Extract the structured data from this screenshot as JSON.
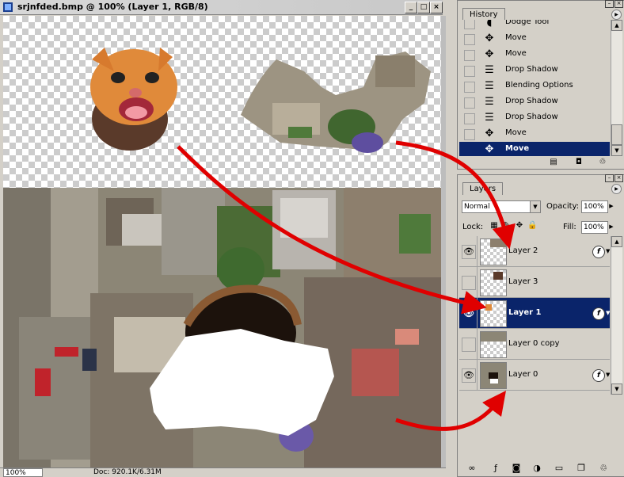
{
  "document": {
    "title": "srjnfded.bmp @ 100% (Layer 1, RGB/8)",
    "window_buttons": {
      "minimize": "_",
      "maximize": "□",
      "close": "×"
    },
    "status": {
      "zoom": "100%",
      "doc_size": "Doc: 920.1K/6.31M"
    }
  },
  "history": {
    "tab_label": "History",
    "items": [
      {
        "label": "Dodge Tool",
        "icon": "dodge-icon",
        "selected": false
      },
      {
        "label": "Move",
        "icon": "move-tool-icon",
        "selected": false
      },
      {
        "label": "Move",
        "icon": "move-tool-icon",
        "selected": false
      },
      {
        "label": "Drop Shadow",
        "icon": "document-step-icon",
        "selected": false
      },
      {
        "label": "Blending Options",
        "icon": "document-step-icon",
        "selected": false
      },
      {
        "label": "Drop Shadow",
        "icon": "document-step-icon",
        "selected": false
      },
      {
        "label": "Drop Shadow",
        "icon": "document-step-icon",
        "selected": false
      },
      {
        "label": "Move",
        "icon": "move-tool-icon",
        "selected": false
      },
      {
        "label": "Move",
        "icon": "move-tool-icon",
        "selected": true
      }
    ]
  },
  "layers": {
    "tab_label": "Layers",
    "blend_mode": "Normal",
    "opacity_label": "Opacity:",
    "opacity": "100%",
    "lock_label": "Lock:",
    "fill_label": "Fill:",
    "fill": "100%",
    "items": [
      {
        "name": "Layer 2",
        "visible": true,
        "effects": true,
        "selected": false
      },
      {
        "name": "Layer 3",
        "visible": false,
        "effects": false,
        "selected": false
      },
      {
        "name": "Layer 1",
        "visible": true,
        "effects": true,
        "selected": true
      },
      {
        "name": "Layer 0 copy",
        "visible": false,
        "effects": false,
        "selected": false
      },
      {
        "name": "Layer 0",
        "visible": true,
        "effects": true,
        "selected": false
      }
    ],
    "fx_symbol": "f"
  },
  "colors": {
    "selection": "#0a246a",
    "panel": "#d4d0c8",
    "annotation_arrow": "#e00000"
  }
}
